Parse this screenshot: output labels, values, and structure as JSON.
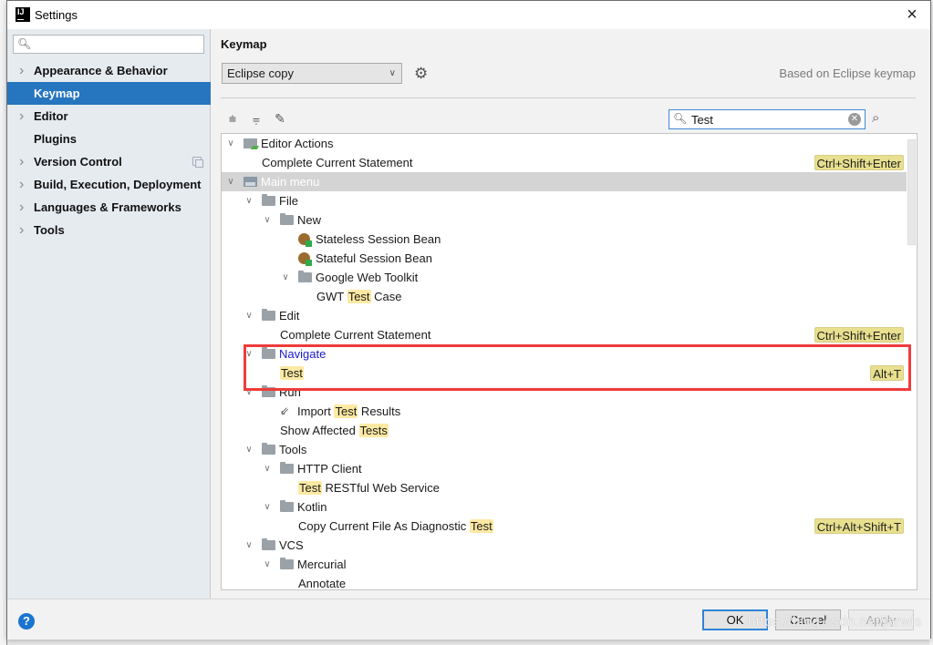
{
  "window": {
    "title": "Settings",
    "app_icon": "intellij-icon",
    "close_icon": "×"
  },
  "sidebar": {
    "search_placeholder": "",
    "search_icon": "search-icon",
    "items": [
      {
        "label": "Appearance & Behavior",
        "expandable": true,
        "selected": false
      },
      {
        "label": "Keymap",
        "expandable": false,
        "selected": true
      },
      {
        "label": "Editor",
        "expandable": true,
        "selected": false
      },
      {
        "label": "Plugins",
        "expandable": false,
        "selected": false
      },
      {
        "label": "Version Control",
        "expandable": true,
        "selected": false,
        "project_icon": true
      },
      {
        "label": "Build, Execution, Deployment",
        "expandable": true,
        "selected": false
      },
      {
        "label": "Languages & Frameworks",
        "expandable": true,
        "selected": false
      },
      {
        "label": "Tools",
        "expandable": true,
        "selected": false
      }
    ]
  },
  "keymap": {
    "heading": "Keymap",
    "selected_keymap": "Eclipse copy",
    "based_on": "Based on Eclipse keymap",
    "search_value": "Test",
    "toolbar": {
      "expand_all": "expand-all-icon",
      "collapse_all": "collapse-all-icon",
      "edit": "edit-icon",
      "find_by_shortcut": "find-shortcut-icon"
    }
  },
  "tree": [
    {
      "depth": 0,
      "expanded": true,
      "icon": "editor-actions",
      "parts": [
        "Editor Actions"
      ],
      "shortcut": ""
    },
    {
      "depth": 1,
      "icon": "",
      "parts": [
        "Complete Current Statement"
      ],
      "shortcut": "Ctrl+Shift+Enter"
    },
    {
      "depth": 0,
      "expanded": true,
      "icon": "main-menu",
      "parts": [
        "Main menu"
      ],
      "shortcut": "",
      "group": true
    },
    {
      "depth": 1,
      "expanded": true,
      "icon": "folder",
      "parts": [
        "File"
      ],
      "shortcut": ""
    },
    {
      "depth": 2,
      "expanded": true,
      "icon": "folder",
      "parts": [
        "New"
      ],
      "shortcut": ""
    },
    {
      "depth": 3,
      "icon": "bean",
      "parts": [
        "Stateless Session Bean"
      ],
      "shortcut": ""
    },
    {
      "depth": 3,
      "icon": "bean",
      "parts": [
        "Stateful Session Bean"
      ],
      "shortcut": ""
    },
    {
      "depth": 3,
      "expanded": true,
      "icon": "folder",
      "parts": [
        "Google Web Toolkit"
      ],
      "shortcut": ""
    },
    {
      "depth": 4,
      "icon": "",
      "parts": [
        "GWT ",
        {
          "hl": "Test"
        },
        " Case"
      ],
      "shortcut": ""
    },
    {
      "depth": 1,
      "expanded": true,
      "icon": "folder",
      "parts": [
        "Edit"
      ],
      "shortcut": ""
    },
    {
      "depth": 2,
      "icon": "",
      "parts": [
        "Complete Current Statement"
      ],
      "shortcut": "Ctrl+Shift+Enter"
    },
    {
      "depth": 1,
      "expanded": true,
      "icon": "folder",
      "parts": [
        "Navigate"
      ],
      "shortcut": "",
      "link": true
    },
    {
      "depth": 2,
      "icon": "",
      "parts": [
        {
          "hl": "Test"
        }
      ],
      "shortcut": "Alt+T"
    },
    {
      "depth": 1,
      "expanded": true,
      "icon": "folder",
      "parts": [
        "Run"
      ],
      "shortcut": ""
    },
    {
      "depth": 2,
      "icon": "import",
      "parts": [
        "Import ",
        {
          "hl": "Test"
        },
        " Results"
      ],
      "shortcut": ""
    },
    {
      "depth": 2,
      "icon": "",
      "parts": [
        "Show Affected ",
        {
          "hl": "Tests"
        }
      ],
      "shortcut": ""
    },
    {
      "depth": 1,
      "expanded": true,
      "icon": "folder",
      "parts": [
        "Tools"
      ],
      "shortcut": ""
    },
    {
      "depth": 2,
      "expanded": true,
      "icon": "folder",
      "parts": [
        "HTTP Client"
      ],
      "shortcut": ""
    },
    {
      "depth": 3,
      "icon": "",
      "parts": [
        {
          "hl": "Test"
        },
        " RESTful Web Service"
      ],
      "shortcut": ""
    },
    {
      "depth": 2,
      "expanded": true,
      "icon": "folder",
      "parts": [
        "Kotlin"
      ],
      "shortcut": ""
    },
    {
      "depth": 3,
      "icon": "",
      "parts": [
        "Copy Current File As Diagnostic ",
        {
          "hl": "Test"
        }
      ],
      "shortcut": "Ctrl+Alt+Shift+T"
    },
    {
      "depth": 1,
      "expanded": true,
      "icon": "folder",
      "parts": [
        "VCS"
      ],
      "shortcut": ""
    },
    {
      "depth": 2,
      "expanded": true,
      "icon": "folder",
      "parts": [
        "Mercurial"
      ],
      "shortcut": ""
    },
    {
      "depth": 3,
      "icon": "",
      "parts": [
        "Annotate"
      ],
      "shortcut": ""
    }
  ],
  "footer": {
    "help": "?",
    "ok": "OK",
    "cancel": "Cancel",
    "apply": "Apply"
  },
  "watermark": "https://blog.csdn.net/jarwis",
  "colors": {
    "accent": "#2675bf",
    "highlight": "#fde9a3",
    "shortcut_bg": "#e8e08e",
    "annotation_box": "#ee3b3b",
    "link": "#1a1acc"
  }
}
